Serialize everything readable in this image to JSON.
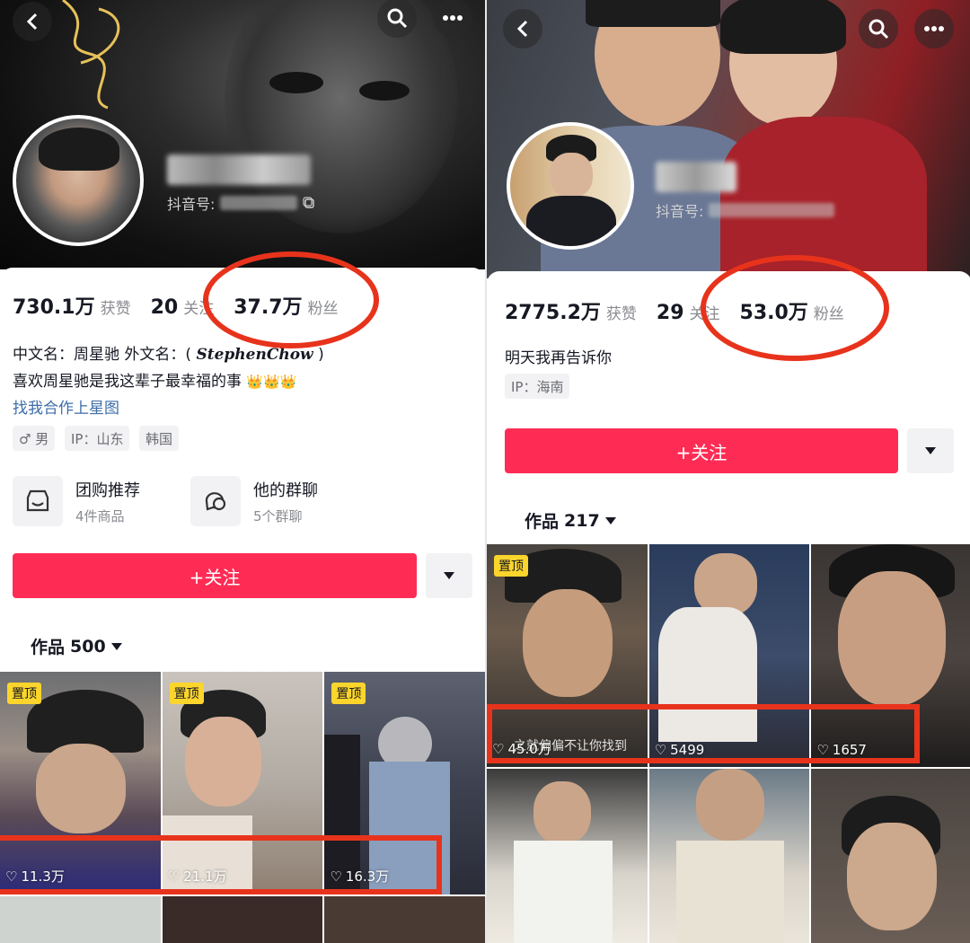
{
  "left": {
    "header": {
      "back_icon": "chevron-left-icon",
      "search_icon": "search-icon",
      "more_icon": "ellipsis-icon"
    },
    "profile": {
      "douyin_id_label": "抖音号:"
    },
    "stats": [
      {
        "value": "730.1万",
        "label": "获赞"
      },
      {
        "value": "20",
        "label": "关注"
      },
      {
        "value": "37.7万",
        "label": "粉丝"
      }
    ],
    "bio": {
      "line1": "中文名：周星驰 外文名：(",
      "line1_en": "StephenChow",
      "line1_end": ")",
      "line2": "喜欢周星驰是我这辈子最幸福的事",
      "crowns": "👑👑👑",
      "link": "找我合作上星图"
    },
    "tags": [
      "♂ 男",
      "IP：山东",
      "韩国"
    ],
    "services": [
      {
        "name": "团购推荐",
        "sub": "4件商品",
        "icon": "shop-icon"
      },
      {
        "name": "他的群聊",
        "sub": "5个群聊",
        "icon": "chat-icon"
      }
    ],
    "follow_label": "+关注",
    "works": {
      "label": "作品",
      "count": "500"
    },
    "videos": [
      {
        "pinned": "置顶",
        "likes": "11.3万"
      },
      {
        "pinned": "置顶",
        "likes": "21.1万"
      },
      {
        "pinned": "置顶",
        "likes": "16.3万"
      }
    ]
  },
  "right": {
    "header": {
      "back_icon": "chevron-left-icon",
      "search_icon": "search-icon",
      "more_icon": "ellipsis-icon"
    },
    "profile": {
      "douyin_id_label": "抖音号:"
    },
    "stats": [
      {
        "value": "2775.2万",
        "label": "获赞"
      },
      {
        "value": "29",
        "label": "关注"
      },
      {
        "value": "53.0万",
        "label": "粉丝"
      }
    ],
    "bio": {
      "line1": "明天我再告诉你"
    },
    "tags": [
      "IP：海南"
    ],
    "follow_label": "+关注",
    "works": {
      "label": "作品",
      "count": "217"
    },
    "videos": [
      {
        "pinned": "置顶",
        "likes": "45.0万",
        "caption": "之就偏偏不让你找到"
      },
      {
        "likes": "5499"
      },
      {
        "likes": "1657"
      }
    ]
  },
  "colors": {
    "accent": "#fe2c55",
    "highlight": "#e8331c",
    "pin": "#fbd52c",
    "link": "#3d6da8"
  }
}
